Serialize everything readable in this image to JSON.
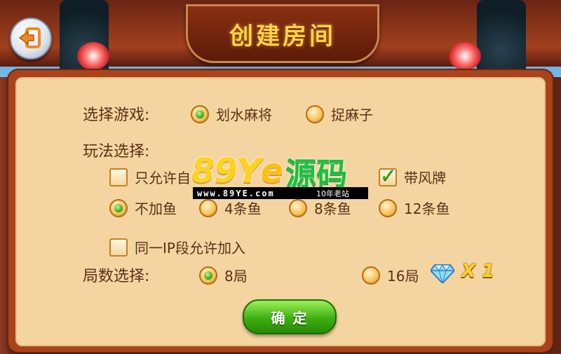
{
  "title": "创建房间",
  "game_select": {
    "label": "选择游戏:",
    "options": [
      {
        "label": "划水麻将",
        "selected": true
      },
      {
        "label": "捉麻子",
        "selected": false
      }
    ]
  },
  "rules": {
    "label": "玩法选择:",
    "checkboxes": [
      {
        "label": "只允许自",
        "checked": false
      },
      {
        "label": "带风牌",
        "checked": true
      }
    ],
    "fish_options": [
      {
        "label": "不加鱼",
        "selected": true
      },
      {
        "label": "4条鱼",
        "selected": false
      },
      {
        "label": "8条鱼",
        "selected": false
      },
      {
        "label": "12条鱼",
        "selected": false
      }
    ],
    "same_ip": {
      "label": "同一IP段允许加入",
      "checked": false
    }
  },
  "rounds": {
    "label": "局数选择:",
    "options": [
      {
        "label": "8局",
        "selected": true
      },
      {
        "label": "16局",
        "selected": false
      }
    ],
    "cost": "X 1",
    "cost_icon": "diamond-icon"
  },
  "confirm_label": "确 定",
  "watermark": {
    "brand_num": "89Y",
    "brand_ye": "e",
    "brand_cn": "源码",
    "url": "www.89YE.com",
    "tag": "10年老站"
  },
  "colors": {
    "panel": "#f4d5a1",
    "title_text": "#ffd44a",
    "confirm": "#3fae12",
    "text": "#5b3016"
  }
}
